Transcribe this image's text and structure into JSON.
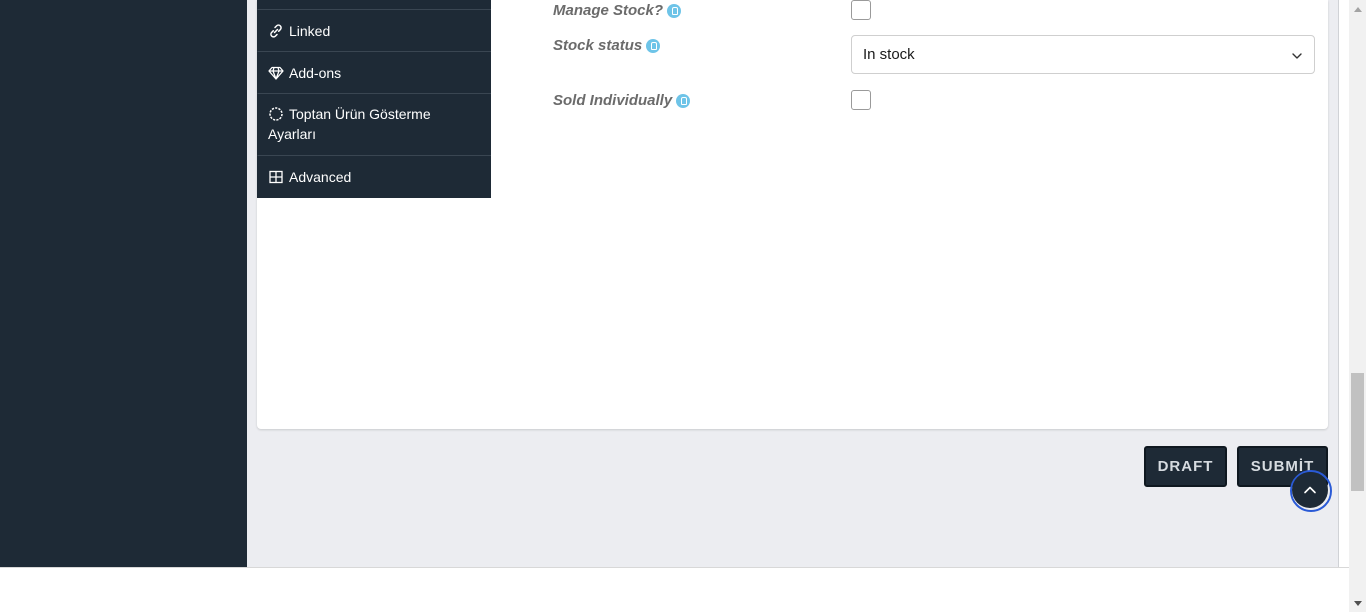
{
  "tabs": [
    {
      "label": ""
    },
    {
      "label": "Linked",
      "icon": "link-icon"
    },
    {
      "label": "Add-ons",
      "icon": "diamond-icon"
    },
    {
      "label": "Toptan Ürün Gösterme Ayarları",
      "icon": "circle-dashed-icon"
    },
    {
      "label": "Advanced",
      "icon": "grid-icon"
    }
  ],
  "inventory": {
    "manage_stock_label": "Manage Stock?",
    "stock_status_label": "Stock status",
    "stock_status_value": "In stock",
    "sold_individually_label": "Sold Individually"
  },
  "actions": {
    "draft_label": "DRAFT",
    "submit_label": "SUBMİT"
  },
  "colors": {
    "sidebar": "#1e2a36",
    "background": "#ecedf1",
    "help_icon": "#6ec4e8",
    "focus_ring": "#2a5ad6"
  }
}
